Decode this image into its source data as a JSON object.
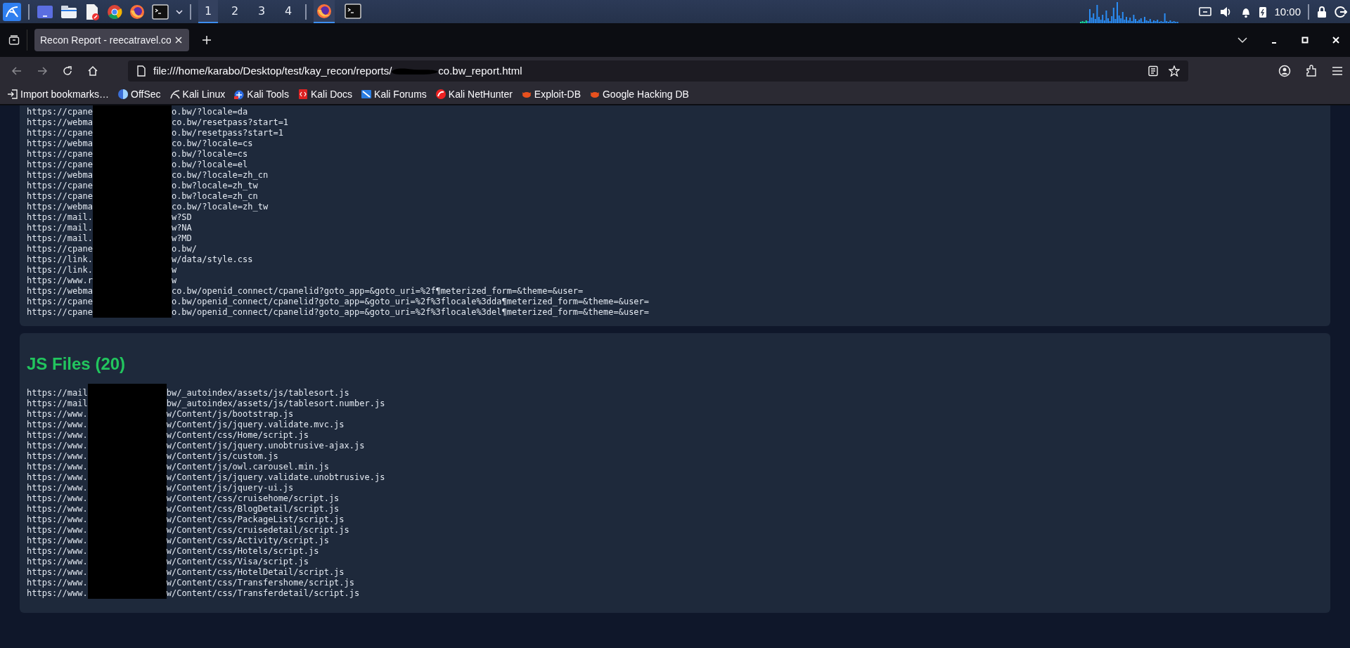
{
  "taskbar": {
    "workspaces": [
      {
        "label": "1",
        "selected": true
      },
      {
        "label": "2",
        "selected": false
      },
      {
        "label": "3",
        "selected": false
      },
      {
        "label": "4",
        "selected": false
      }
    ],
    "tasks": [
      {
        "kind": "firefox",
        "selected": true
      },
      {
        "kind": "terminal",
        "selected": false
      }
    ],
    "clock": "10:00"
  },
  "browser": {
    "tabs": [
      {
        "title": "Recon Report - reecatravel.co",
        "selected": true
      }
    ],
    "url": {
      "start": "file:///home/karabo/Desktop/test/kay_recon/reports/",
      "end": "co.bw_report.html"
    },
    "bookmarks": [
      {
        "label": "Import bookmarks…"
      },
      {
        "label": "OffSec"
      },
      {
        "label": "Kali Linux"
      },
      {
        "label": "Kali Tools"
      },
      {
        "label": "Kali Docs"
      },
      {
        "label": "Kali Forums"
      },
      {
        "label": "Kali NetHunter"
      },
      {
        "label": "Exploit-DB"
      },
      {
        "label": "Google Hacking DB"
      }
    ]
  },
  "sections": [
    {
      "lines": [
        {
          "start": "https://cpane",
          "end": "o.bw/?locale=da"
        },
        {
          "start": "https://webma",
          "end": "co.bw/resetpass?start=1"
        },
        {
          "start": "https://cpane",
          "end": "o.bw/resetpass?start=1"
        },
        {
          "start": "https://webma",
          "end": "co.bw/?locale=cs"
        },
        {
          "start": "https://cpane",
          "end": "o.bw/?locale=cs"
        },
        {
          "start": "https://cpane",
          "end": "o.bw/?locale=el"
        },
        {
          "start": "https://webma",
          "end": "co.bw/?locale=zh_cn"
        },
        {
          "start": "https://cpane",
          "end": "o.bw?locale=zh_tw"
        },
        {
          "start": "https://cpane",
          "end": "o.bw?locale=zh_cn"
        },
        {
          "start": "https://webma",
          "end": "co.bw/?locale=zh_tw"
        },
        {
          "start": "https://mail.",
          "end": "w?SD"
        },
        {
          "start": "https://mail.",
          "end": "w?NA"
        },
        {
          "start": "https://mail.",
          "end": "w?MD"
        },
        {
          "start": "https://cpane",
          "end": "o.bw/"
        },
        {
          "start": "https://link.",
          "end": "w/data/style.css"
        },
        {
          "start": "https://link.",
          "end": "w"
        },
        {
          "start": "https://www.r",
          "end": "w"
        },
        {
          "start": "https://webma",
          "end": "co.bw/openid_connect/cpanelid?goto_app=&goto_uri=%2f¶meterized_form=&theme=&user="
        },
        {
          "start": "https://cpane",
          "end": "o.bw/openid_connect/cpanelid?goto_app=&goto_uri=%2f%3flocale%3dda¶meterized_form=&theme=&user="
        },
        {
          "start": "https://cpane",
          "end": "o.bw/openid_connect/cpanelid?goto_app=&goto_uri=%2f%3flocale%3del¶meterized_form=&theme=&user="
        }
      ]
    },
    {
      "title": "JS Files (20)",
      "lines": [
        {
          "start": "https://mail",
          "end": "bw/_autoindex/assets/js/tablesort.js"
        },
        {
          "start": "https://mail",
          "end": "bw/_autoindex/assets/js/tablesort.number.js"
        },
        {
          "start": "https://www.",
          "end": "w/Content/js/bootstrap.js"
        },
        {
          "start": "https://www.",
          "end": "w/Content/js/jquery.validate.mvc.js"
        },
        {
          "start": "https://www.",
          "end": "w/Content/css/Home/script.js"
        },
        {
          "start": "https://www.",
          "end": "w/Content/js/jquery.unobtrusive-ajax.js"
        },
        {
          "start": "https://www.",
          "end": "w/Content/js/custom.js"
        },
        {
          "start": "https://www.",
          "end": "w/Content/js/owl.carousel.min.js"
        },
        {
          "start": "https://www.",
          "end": "w/Content/js/jquery.validate.unobtrusive.js"
        },
        {
          "start": "https://www.",
          "end": "w/Content/js/jquery-ui.js"
        },
        {
          "start": "https://www.",
          "end": "w/Content/css/cruisehome/script.js"
        },
        {
          "start": "https://www.",
          "end": "w/Content/css/BlogDetail/script.js"
        },
        {
          "start": "https://www.",
          "end": "w/Content/css/PackageList/script.js"
        },
        {
          "start": "https://www.",
          "end": "w/Content/css/cruisedetail/script.js"
        },
        {
          "start": "https://www.",
          "end": "w/Content/css/Activity/script.js"
        },
        {
          "start": "https://www.",
          "end": "w/Content/css/Hotels/script.js"
        },
        {
          "start": "https://www.",
          "end": "w/Content/css/Visa/script.js"
        },
        {
          "start": "https://www.",
          "end": "w/Content/css/HotelDetail/script.js"
        },
        {
          "start": "https://www.",
          "end": "w/Content/css/Transfershome/script.js"
        },
        {
          "start": "https://www.",
          "end": "w/Content/css/Transferdetail/script.js"
        }
      ]
    }
  ]
}
